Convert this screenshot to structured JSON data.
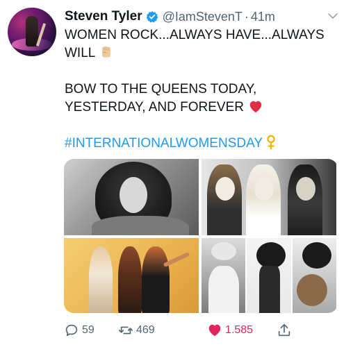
{
  "tweet": {
    "author_name": "Steven Tyler",
    "handle": "@IamStevenT",
    "separator": "·",
    "time": "41m",
    "lines": [
      "WOMEN ROCK...ALWAYS HAVE...ALWAYS",
      "WILL",
      "BOW TO THE QUEENS TODAY,",
      "YESTERDAY, AND FOREVER",
      "#INTERNATIONALWOMENSDAY"
    ],
    "emojis": [
      "raised-fist-icon",
      "red-heart-icon",
      "female-sign-icon"
    ]
  },
  "actions": {
    "replies": "59",
    "retweets": "469",
    "likes": "1.585"
  },
  "colors": {
    "text": "#0f1419",
    "secondary": "#536471",
    "link": "#1d9bf0",
    "like": "#e0245e",
    "verified": "#1d9bf0"
  }
}
